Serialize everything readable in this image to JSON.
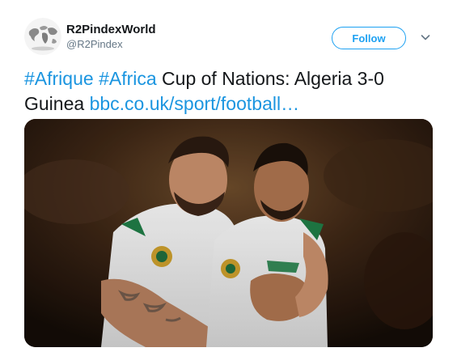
{
  "author": {
    "display_name": "R2PindexWorld",
    "handle": "@R2Pindex",
    "avatar_icon": "world-map-avatar-icon"
  },
  "follow_button": {
    "label": "Follow",
    "color": "#1da1f2"
  },
  "menu": {
    "icon": "chevron-down-icon"
  },
  "tweet": {
    "hashtag_1": "#Afrique",
    "hashtag_2": "#Africa",
    "body": "Cup of Nations: Algeria 3-0 Guinea",
    "link": "bbc.co.uk/sport/football…",
    "link_color": "#1b95e0"
  },
  "media": {
    "subject": "photo-two-football-players-celebrating"
  }
}
